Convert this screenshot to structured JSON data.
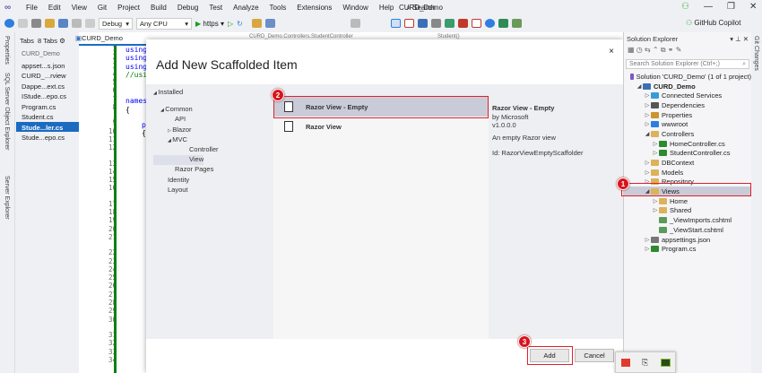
{
  "menubar": {
    "items": [
      "File",
      "Edit",
      "View",
      "Git",
      "Project",
      "Build",
      "Debug",
      "Test",
      "Analyze",
      "Tools",
      "Extensions",
      "Window",
      "Help"
    ],
    "search": "Search",
    "title": "CURD_Demo"
  },
  "toolbar": {
    "config": "Debug",
    "platform": "Any CPU",
    "run": "https",
    "copilot": "GitHub Copilot"
  },
  "left_strip": [
    "Properties",
    "SQL Server Object Explorer",
    "Server Explorer"
  ],
  "tabs_panel": {
    "header": "Tabs",
    "count": "8 Tabs",
    "group": "CURD_Demo",
    "items": [
      "appset...s.json",
      "CURD_...rview",
      "Dappe...ext.cs",
      "IStude...epo.cs",
      "Program.cs",
      "Student.cs",
      "Stude...ler.cs",
      "Stude...epo.cs"
    ],
    "selected": 6
  },
  "editor": {
    "tab1": "CURD_Demo",
    "tab2": "CURD_Demo.Controllers.StudentController",
    "tab3": "Student()",
    "code": [
      "using",
      "using",
      "using",
      "//usi",
      "",
      "",
      "names",
      "{",
      "",
      "p",
      "{"
    ],
    "line_numbers": [
      "1",
      "2",
      "3",
      "4",
      "5",
      "6",
      "7",
      "8",
      "9",
      "10",
      "11",
      "12",
      "13",
      "14",
      "15",
      "16",
      "17",
      "18",
      "19",
      "20",
      "21",
      "22",
      "23",
      "24",
      "25",
      "26",
      "27",
      "28",
      "29",
      "30",
      "31",
      "32",
      "33",
      "34"
    ]
  },
  "dialog": {
    "title": "Add New Scaffolded Item",
    "close": "×",
    "tree": [
      "Installed",
      "Common",
      "API",
      "Blazor",
      "MVC",
      "Controller",
      "View",
      "Razor Pages",
      "Identity",
      "Layout"
    ],
    "templates": [
      "Razor View - Empty",
      "Razor View"
    ],
    "details": {
      "name": "Razor View - Empty",
      "author": "by Microsoft",
      "version": "v1.0.0.0",
      "description": "An empty Razor view",
      "id": "Id: RazorViewEmptyScaffolder"
    },
    "add": "Add",
    "cancel": "Cancel"
  },
  "solution_explorer": {
    "title": "Solution Explorer",
    "search_placeholder": "Search Solution Explorer (Ctrl+;)",
    "nodes": [
      {
        "label": "Solution 'CURD_Demo' (1 of 1 project)",
        "depth": 0,
        "arrow": "",
        "icon": "#7a5bbf"
      },
      {
        "label": "CURD_Demo",
        "depth": 1,
        "arrow": "◢",
        "icon": "#3b6fb5",
        "bold": true
      },
      {
        "label": "Connected Services",
        "depth": 2,
        "arrow": "▷",
        "icon": "#3a9ad9"
      },
      {
        "label": "Dependencies",
        "depth": 2,
        "arrow": "▷",
        "icon": "#555"
      },
      {
        "label": "Properties",
        "depth": 2,
        "arrow": "▷",
        "icon": "#c8962d"
      },
      {
        "label": "wwwroot",
        "depth": 2,
        "arrow": "▷",
        "icon": "#2f7de1"
      },
      {
        "label": "Controllers",
        "depth": 2,
        "arrow": "◢",
        "icon": "#dcb25a"
      },
      {
        "label": "HomeController.cs",
        "depth": 3,
        "arrow": "▷",
        "icon": "#2d8a2d"
      },
      {
        "label": "StudentController.cs",
        "depth": 3,
        "arrow": "▷",
        "icon": "#2d8a2d"
      },
      {
        "label": "DBContext",
        "depth": 2,
        "arrow": "▷",
        "icon": "#dcb25a"
      },
      {
        "label": "Models",
        "depth": 2,
        "arrow": "▷",
        "icon": "#dcb25a"
      },
      {
        "label": "Repository",
        "depth": 2,
        "arrow": "▷",
        "icon": "#dcb25a"
      },
      {
        "label": "Views",
        "depth": 2,
        "arrow": "◢",
        "icon": "#dcb25a",
        "selected": true
      },
      {
        "label": "Home",
        "depth": 3,
        "arrow": "▷",
        "icon": "#dcb25a"
      },
      {
        "label": "Shared",
        "depth": 3,
        "arrow": "▷",
        "icon": "#dcb25a"
      },
      {
        "label": "_ViewImports.cshtml",
        "depth": 3,
        "arrow": "",
        "icon": "#5a9a5a"
      },
      {
        "label": "_ViewStart.cshtml",
        "depth": 3,
        "arrow": "",
        "icon": "#5a9a5a"
      },
      {
        "label": "appsettings.json",
        "depth": 2,
        "arrow": "▷",
        "icon": "#777"
      },
      {
        "label": "Program.cs",
        "depth": 2,
        "arrow": "▷",
        "icon": "#2d8a2d"
      }
    ]
  },
  "git_changes": "Git Changes",
  "steps": [
    "1",
    "2",
    "3"
  ],
  "colors": {
    "accent": "#1c6bc1",
    "annotation": "#e0202a",
    "selection": "#c9ccd8"
  }
}
